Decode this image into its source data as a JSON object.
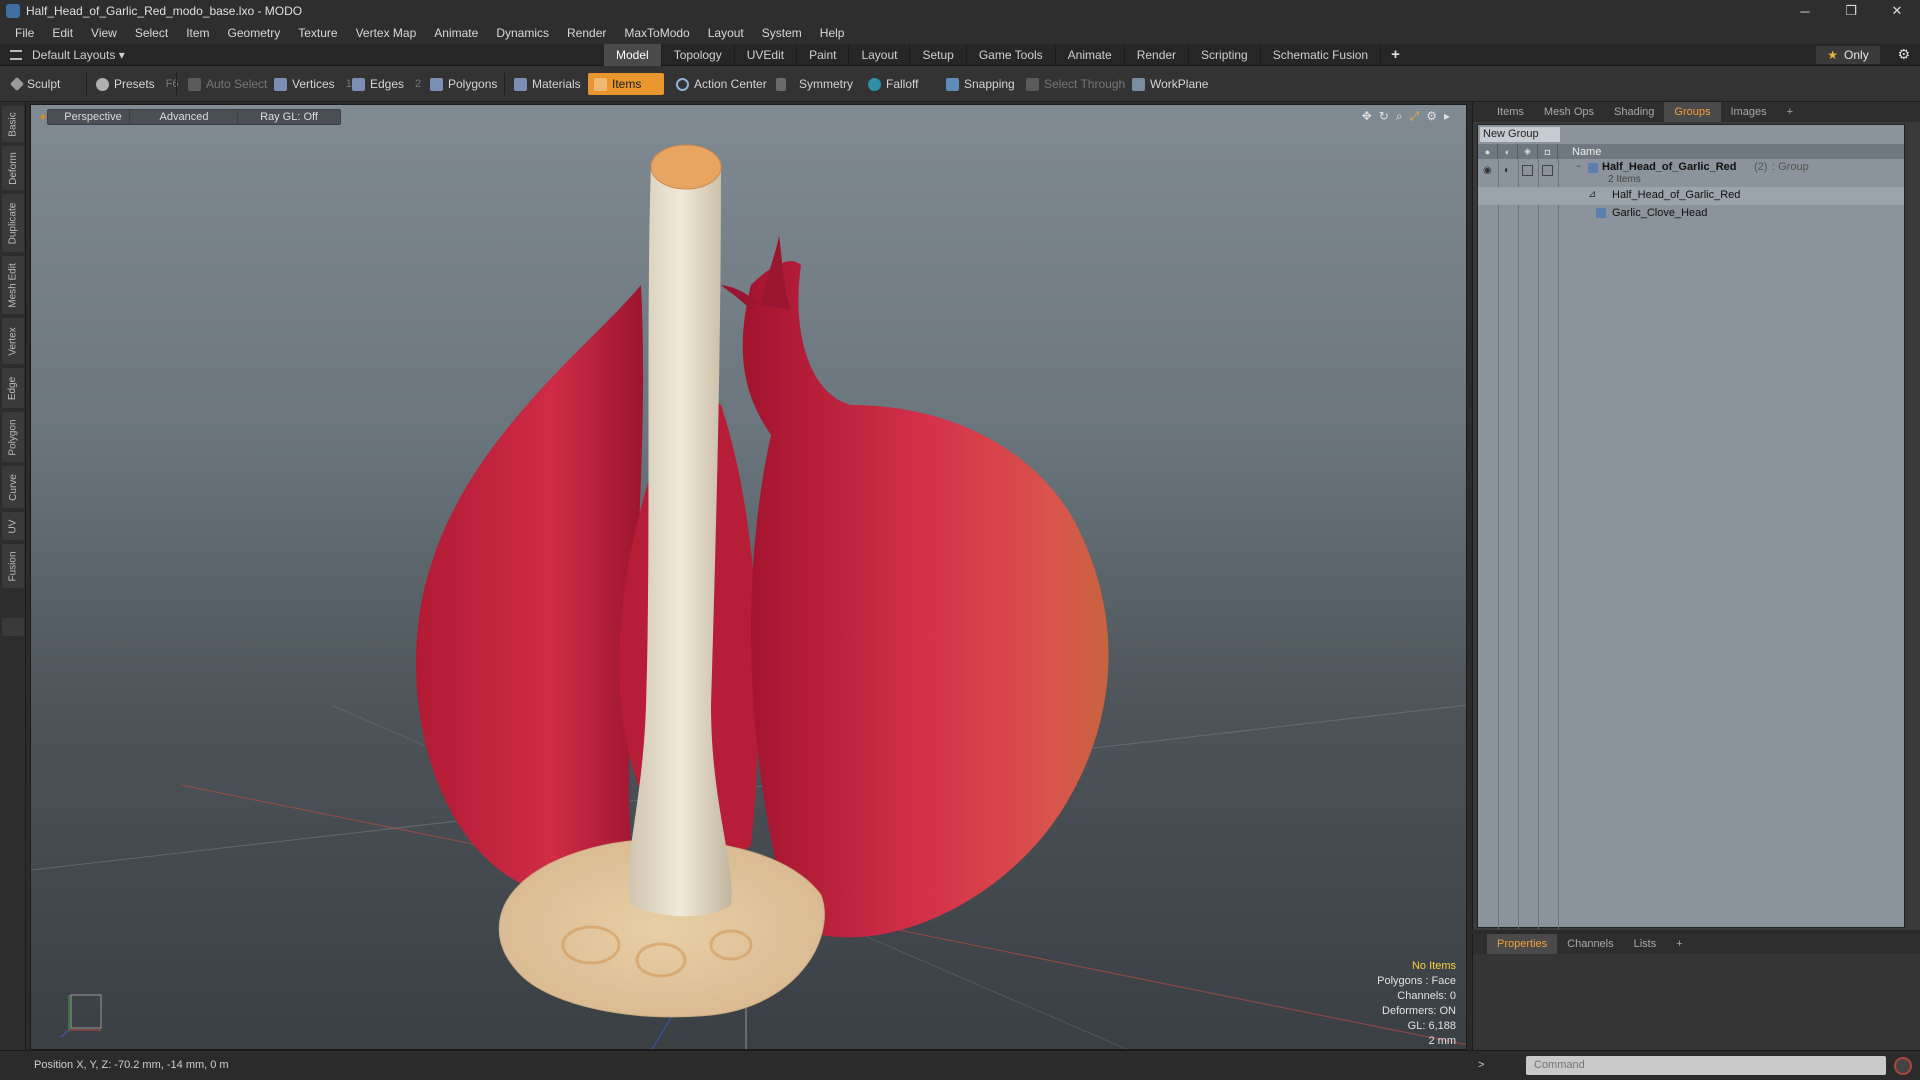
{
  "window": {
    "title": "Half_Head_of_Garlic_Red_modo_base.lxo - MODO",
    "minimize": "─",
    "restore": "❐",
    "close": "✕"
  },
  "menu": [
    "File",
    "Edit",
    "View",
    "Select",
    "Item",
    "Geometry",
    "Texture",
    "Vertex Map",
    "Animate",
    "Dynamics",
    "Render",
    "MaxToModo",
    "Layout",
    "System",
    "Help"
  ],
  "layout_bar": {
    "layouts_label": "Default Layouts ▾",
    "tabs": [
      "Model",
      "Topology",
      "UVEdit",
      "Paint",
      "Layout",
      "Setup",
      "Game Tools",
      "Animate",
      "Render",
      "Scripting",
      "Schematic Fusion"
    ],
    "active_tab": "Model",
    "add_tab": "+",
    "only_label": "Only",
    "star": "★",
    "gear": "⚙"
  },
  "toolbar": {
    "sculpt": "Sculpt",
    "presets": "Presets",
    "presets_key": "F6",
    "auto_select": "Auto Select",
    "vertices": "Vertices",
    "vertices_key": "1",
    "edges": "Edges",
    "edges_key": "2",
    "polygons": "Polygons",
    "materials": "Materials",
    "items": "Items",
    "action_center": "Action Center",
    "symmetry": "Symmetry",
    "falloff": "Falloff",
    "snapping": "Snapping",
    "select_through": "Select Through",
    "workplane": "WorkPlane"
  },
  "left_tabs": [
    "Basic",
    "Deform",
    "Duplicate",
    "Mesh Edit",
    "Vertex",
    "Edge",
    "Polygon",
    "Curve",
    "UV",
    "Fusion"
  ],
  "viewport": {
    "view_mode": "Perspective",
    "shading": "Advanced",
    "raygl": "Ray GL: Off",
    "info": {
      "selection": "No Items",
      "polygons": "Polygons : Face",
      "channels": "Channels: 0",
      "deformers": "Deformers: ON",
      "gl": "GL: 6,188",
      "scale": "2 mm"
    }
  },
  "right_panel": {
    "tabs": [
      "Items",
      "Mesh Ops",
      "Shading",
      "Groups",
      "Images",
      "+"
    ],
    "active_tab": "Groups",
    "new_group": "New Group",
    "column_name": "Name",
    "group": {
      "name": "Half_Head_of_Garlic_Red",
      "count": "(2)",
      "type": ": Group",
      "subtitle": "2 Items",
      "children": [
        "Half_Head_of_Garlic_Red",
        "Garlic_Clove_Head"
      ]
    }
  },
  "bottom_panel": {
    "tabs": [
      "Properties",
      "Channels",
      "Lists",
      "+"
    ],
    "active_tab": "Properties"
  },
  "status": {
    "position": "Position X, Y, Z:  -70.2 mm, -14 mm, 0 m",
    "command_prompt": ">",
    "command_placeholder": "Command"
  },
  "colors": {
    "accent": "#e8962d",
    "active_tab_text": "#f3a13b",
    "garlic_skin": "#c4223d",
    "garlic_stem": "#e6ddcb"
  }
}
